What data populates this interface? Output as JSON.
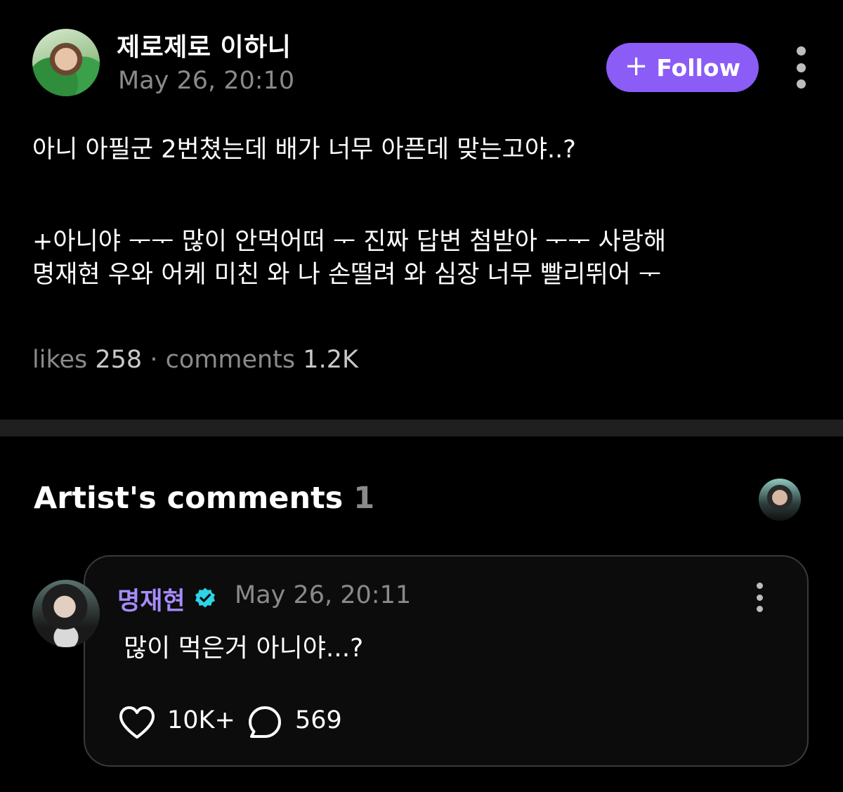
{
  "post": {
    "author": "제로제로 이하니",
    "date": "May 26, 20:10",
    "follow_label": "Follow",
    "body_lines": [
      "아니 아필군 2번쳤는데 배가 너무 아픈데 맞는고야..?",
      "+아니야 ᅮᅮ 많이 안먹어떠 ᅮ 진짜 답변 첨받아 ᅮᅮ 사랑해",
      "명재현 우와 어케 미친 와 나 손떨려 와 심장 너무 빨리뛰어 ᅮ"
    ],
    "likes_label": "likes",
    "likes_count": "258",
    "separator": "·",
    "comments_label": "comments",
    "comments_count": "1.2K"
  },
  "artist_comments": {
    "title": "Artist's comments",
    "count": "1",
    "comment": {
      "name": "명재현",
      "verified": true,
      "date": "May 26, 20:11",
      "text": "많이 먹은거 아니야...?",
      "like_count": "10K+",
      "reply_count": "569"
    }
  },
  "colors": {
    "background": "#000000",
    "accent": "#8b5cf6",
    "artist_name": "#a78bfa",
    "verified": "#2dd4e6",
    "muted": "#8a8a8a"
  },
  "icons": [
    "plus-icon",
    "more-vertical-icon",
    "verified-badge-icon",
    "heart-icon",
    "comment-bubble-icon"
  ]
}
